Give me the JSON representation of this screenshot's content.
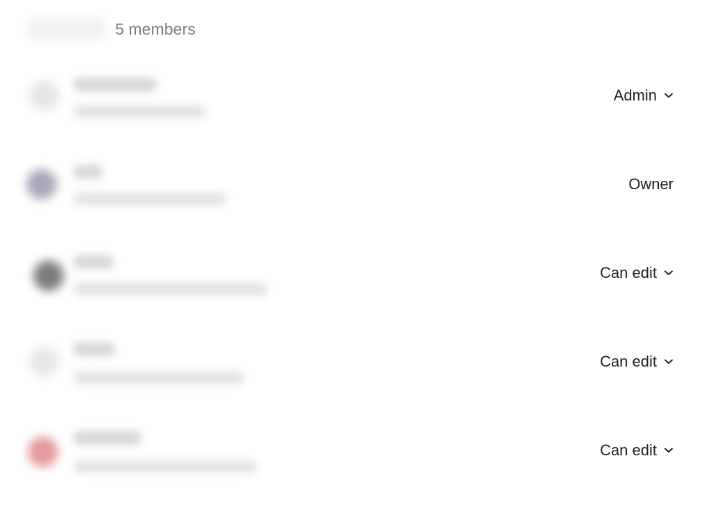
{
  "header": {
    "member_count": "5 members"
  },
  "members": [
    {
      "role": "Admin",
      "role_editable": true,
      "avatar_color": "#e6e6e6"
    },
    {
      "role": "Owner",
      "role_editable": false,
      "avatar_color": "#a9a9b7"
    },
    {
      "role": "Can edit",
      "role_editable": true,
      "avatar_color": "#7c7c7c"
    },
    {
      "role": "Can edit",
      "role_editable": true,
      "avatar_color": "#e8e8e8"
    },
    {
      "role": "Can edit",
      "role_editable": true,
      "avatar_color": "#e39a9a"
    }
  ]
}
